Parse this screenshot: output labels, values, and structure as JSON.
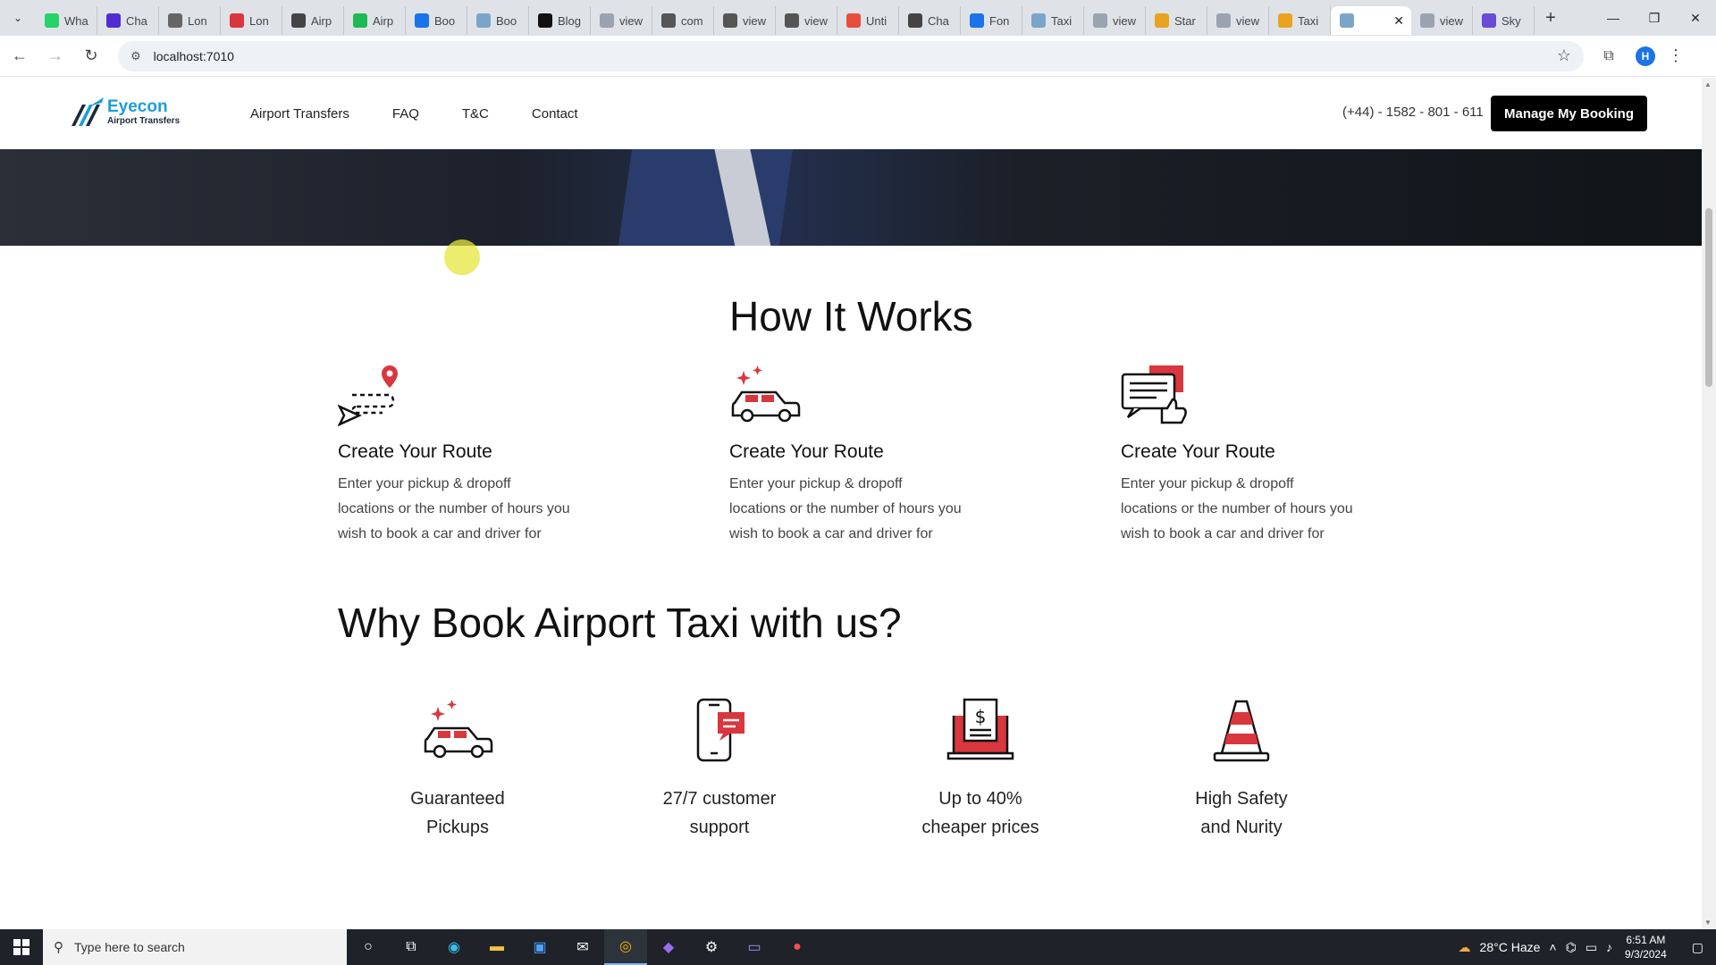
{
  "browser": {
    "tabs": [
      {
        "label": "Wha",
        "color": "#25d366"
      },
      {
        "label": "Cha",
        "color": "#512bd4"
      },
      {
        "label": "Lon",
        "color": "#666666"
      },
      {
        "label": "Lon",
        "color": "#d9363e"
      },
      {
        "label": "Airp",
        "color": "#444444"
      },
      {
        "label": "Airp",
        "color": "#1db954"
      },
      {
        "label": "Boo",
        "color": "#1a73e8"
      },
      {
        "label": "Boo",
        "color": "#7aa5c9"
      },
      {
        "label": "Blog",
        "color": "#111111"
      },
      {
        "label": "view",
        "color": "#9aa3b0"
      },
      {
        "label": "com",
        "color": "#555555"
      },
      {
        "label": "view",
        "color": "#555555"
      },
      {
        "label": "view",
        "color": "#555555"
      },
      {
        "label": "Unti",
        "color": "#e94e3c"
      },
      {
        "label": "Cha",
        "color": "#444444"
      },
      {
        "label": "Fon",
        "color": "#1a73e8"
      },
      {
        "label": "Taxi",
        "color": "#7aa5c9"
      },
      {
        "label": "view",
        "color": "#9aa3b0"
      },
      {
        "label": "Star",
        "color": "#e8a321"
      },
      {
        "label": "view",
        "color": "#9aa3b0"
      },
      {
        "label": "Taxi",
        "color": "#e8a321"
      }
    ],
    "active_tab": {
      "label": "",
      "close": "✕"
    },
    "after_tabs": [
      {
        "label": "view",
        "color": "#9aa3b0"
      },
      {
        "label": "Sky",
        "color": "#6a4bd6"
      }
    ],
    "url": "localhost:7010",
    "profile_initial": "H"
  },
  "site": {
    "logo_name": "Eyecon",
    "logo_sub": "Airport Transfers",
    "menu": [
      "Airport Transfers",
      "FAQ",
      "T&C",
      "Contact"
    ],
    "phone": "(+44) - 1582 - 801 - 611",
    "manage_button": "Manage My Booking"
  },
  "how_it_works": {
    "title": "How It Works",
    "steps": [
      {
        "icon": "route-pin-icon",
        "title": "Create Your Route",
        "text": "Enter your pickup & dropoff locations or the number of hours you wish to book a car and driver for"
      },
      {
        "icon": "car-sparkle-icon",
        "title": "Create Your Route",
        "text": "Enter your pickup & dropoff locations or the number of hours you wish to book a car and driver for"
      },
      {
        "icon": "chat-thumbs-up-icon",
        "title": "Create Your Route",
        "text": "Enter your pickup & dropoff locations or the number of hours you wish to book a car and driver for"
      }
    ]
  },
  "why_book": {
    "title": "Why Book Airport Taxi with us?",
    "features": [
      {
        "icon": "car-sparkle-icon",
        "line1": "Guaranteed",
        "line2": "Pickups"
      },
      {
        "icon": "phone-chat-icon",
        "line1": "27/7 customer",
        "line2": "support"
      },
      {
        "icon": "laptop-dollar-icon",
        "line1": "Up to 40%",
        "line2": "cheaper prices"
      },
      {
        "icon": "traffic-cone-icon",
        "line1": "High Safety",
        "line2": "and Nurity"
      }
    ]
  },
  "taskbar": {
    "search_placeholder": "Type here to search",
    "weather": "28°C  Haze",
    "time": "6:51 AM",
    "date": "9/3/2024"
  },
  "colors": {
    "accent_red": "#d9363e",
    "logo_blue": "#1a9fd6",
    "button_black": "#000000"
  }
}
